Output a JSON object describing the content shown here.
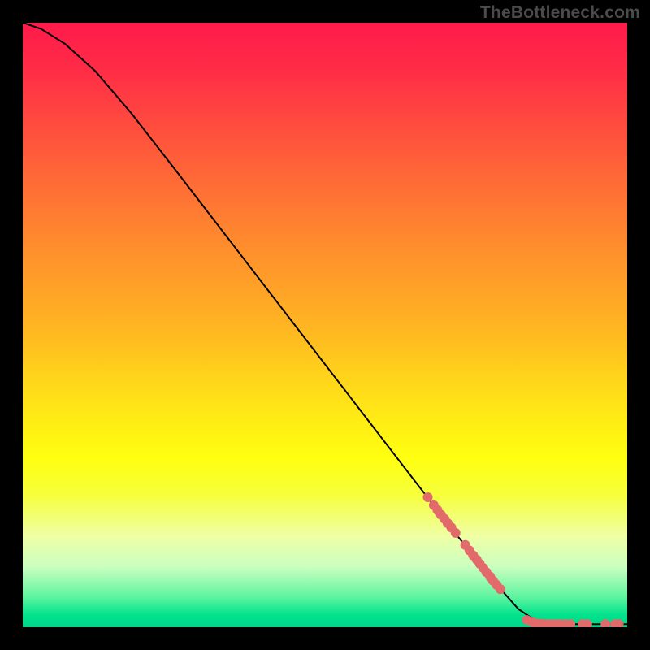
{
  "watermark": "TheBottleneck.com",
  "colors": {
    "dot": "#e26a6a",
    "curve": "#000000"
  },
  "chart_data": {
    "type": "line",
    "title": "",
    "xlabel": "",
    "ylabel": "",
    "xlim": [
      0,
      100
    ],
    "ylim": [
      0,
      100
    ],
    "grid": false,
    "legend": false,
    "curve": [
      {
        "x": 0,
        "y": 100
      },
      {
        "x": 3,
        "y": 99
      },
      {
        "x": 7,
        "y": 96.5
      },
      {
        "x": 12,
        "y": 92
      },
      {
        "x": 18,
        "y": 85
      },
      {
        "x": 25,
        "y": 76
      },
      {
        "x": 35,
        "y": 63
      },
      {
        "x": 45,
        "y": 50
      },
      {
        "x": 55,
        "y": 37
      },
      {
        "x": 65,
        "y": 24
      },
      {
        "x": 72,
        "y": 15
      },
      {
        "x": 78,
        "y": 7.5
      },
      {
        "x": 82,
        "y": 3
      },
      {
        "x": 85,
        "y": 1
      },
      {
        "x": 88,
        "y": 0.5
      },
      {
        "x": 100,
        "y": 0.5
      }
    ],
    "series": [
      {
        "name": "points",
        "marker": "dot",
        "points_xy": [
          [
            67,
            21.5
          ],
          [
            68,
            20.2
          ],
          [
            68.6,
            19.4
          ],
          [
            69.2,
            18.6
          ],
          [
            69.8,
            17.9
          ],
          [
            70.3,
            17.2
          ],
          [
            70.9,
            16.5
          ],
          [
            71.6,
            15.6
          ],
          [
            73.2,
            13.6
          ],
          [
            73.9,
            12.7
          ],
          [
            74.5,
            11.9
          ],
          [
            75.1,
            11.2
          ],
          [
            75.6,
            10.5
          ],
          [
            76.2,
            9.8
          ],
          [
            76.7,
            9.1
          ],
          [
            77.3,
            8.4
          ],
          [
            77.8,
            7.7
          ],
          [
            78.4,
            7.0
          ],
          [
            79.0,
            6.3
          ],
          [
            83.4,
            1.2
          ],
          [
            84.4,
            0.8
          ],
          [
            85.3,
            0.6
          ],
          [
            86.1,
            0.55
          ],
          [
            86.8,
            0.5
          ],
          [
            87.5,
            0.5
          ],
          [
            88.1,
            0.5
          ],
          [
            88.8,
            0.5
          ],
          [
            89.7,
            0.5
          ],
          [
            90.6,
            0.5
          ],
          [
            92.6,
            0.5
          ],
          [
            93.4,
            0.5
          ],
          [
            96.4,
            0.5
          ],
          [
            98.0,
            0.5
          ],
          [
            98.6,
            0.5
          ]
        ]
      }
    ]
  }
}
